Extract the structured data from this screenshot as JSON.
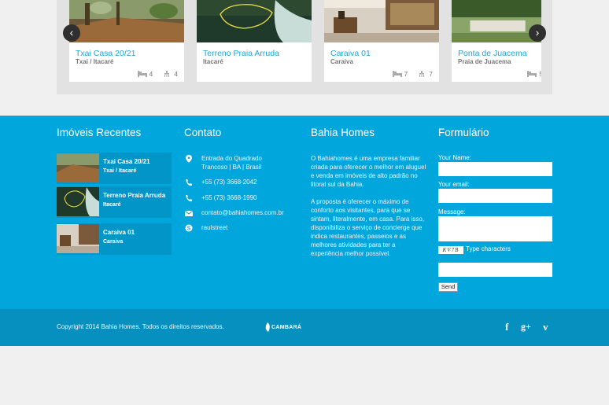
{
  "carousel": {
    "prev_icon": "chevron-left-icon",
    "next_icon": "chevron-right-icon",
    "cards": [
      {
        "title": "Txai Casa 20/21",
        "location": "Txai / Itacaré",
        "bedrooms": "4",
        "bathrooms": "4"
      },
      {
        "title": "Terreno Praia Arruda",
        "location": "Itacaré"
      },
      {
        "title": "Caraiva 01",
        "location": "Caraiva",
        "bedrooms": "7",
        "bathrooms": "7"
      },
      {
        "title": "Ponta de Juacema",
        "location": "Praia de Juacema",
        "bedrooms": "5"
      }
    ]
  },
  "footer": {
    "recent": {
      "heading": "Imóveis Recentes",
      "items": [
        {
          "title": "Txai Casa 20/21",
          "location": "Txai / Itacaré"
        },
        {
          "title": "Terreno Praia Arruda",
          "location": "Itacaré"
        },
        {
          "title": "Caraiva 01",
          "location": "Caraiva"
        }
      ]
    },
    "contact": {
      "heading": "Contato",
      "address_line1": "Entrada do Quadrado",
      "address_line2": "Trancoso | BA | Brasil",
      "phone1": "+55 (73) 3668-2042",
      "phone2": "+55 (73) 3668-1990",
      "email": "contato@bahiahomes.com.br",
      "skype": "raulstreet"
    },
    "about": {
      "heading": "Bahia Homes",
      "paragraph1": "O Bahiahomes é uma empresa familiar criada para oferecer o melhor em aluguel e venda em imóveis de alto padrão no litoral sul da Bahia.",
      "paragraph2": "A proposta é oferecer o máximo de conforto aos visitantes, para que se sintam, literalmente, em casa. Para isso, disponibiliza o serviço de concierge que indica restaurantes, passeios e as melhores atividades para ter a experiência melhor possível."
    },
    "form": {
      "heading": "Formulário",
      "name_label": "Your Name:",
      "email_label": "Your email:",
      "message_label": "Message:",
      "captcha_code": "KV7B",
      "captcha_label": "Type characters",
      "send_label": "Send"
    },
    "bottom": {
      "copyright": "Copyright 2014 Bahia Homes. Todos os direitos reservados.",
      "brand": "CAMBARÁ",
      "social": [
        "facebook-icon",
        "google-plus-icon",
        "vimeo-icon"
      ]
    }
  },
  "colors": {
    "footer_bg": "#00a6dc",
    "bottom_bar_bg": "#0590c0",
    "accent_title": "#1ea6d6",
    "page_bg": "#f0f0f0"
  }
}
